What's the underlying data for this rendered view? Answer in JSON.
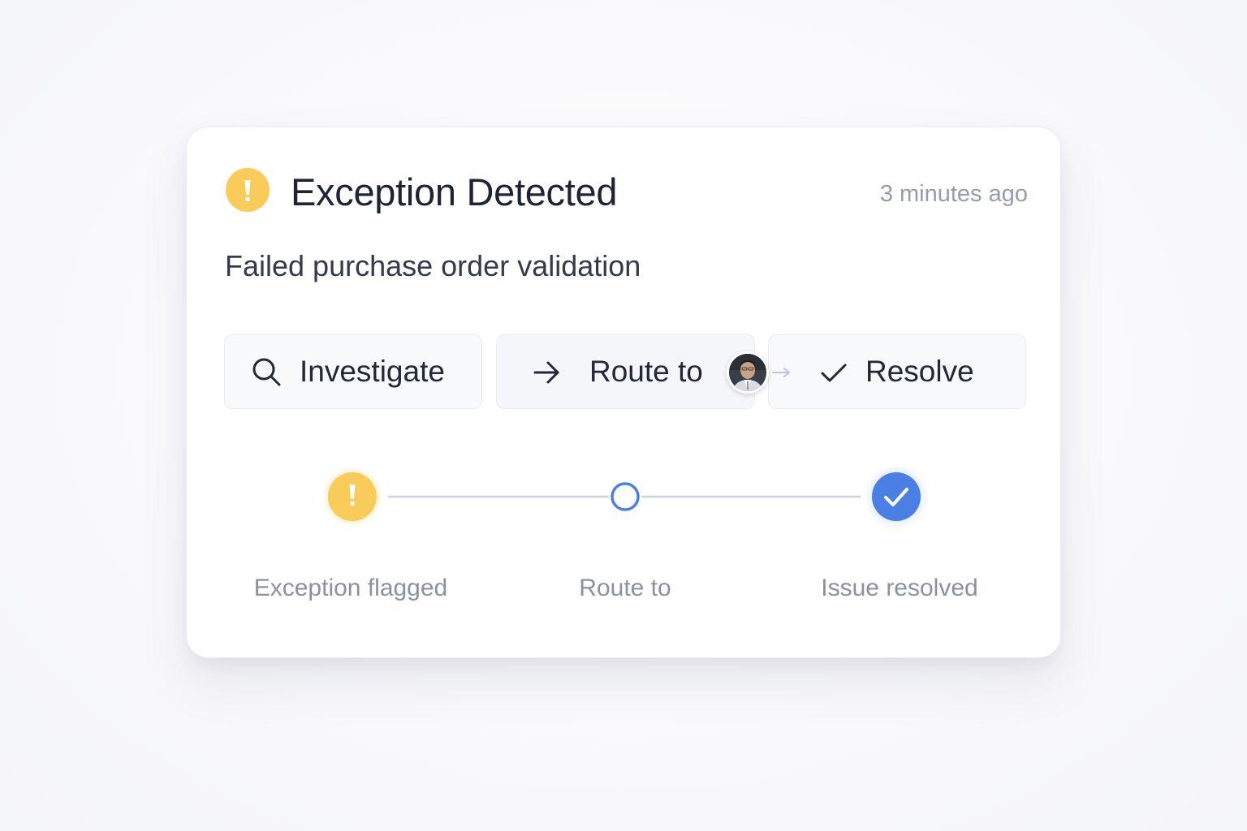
{
  "header": {
    "icon": "warning-icon",
    "title": "Exception Detected",
    "timestamp": "3 minutes ago"
  },
  "description": "Failed purchase order validation",
  "actions": [
    {
      "icon": "search-icon",
      "label": "Investigate"
    },
    {
      "icon": "arrow-right-icon",
      "label": "Route to",
      "assignee_icon": "avatar"
    },
    {
      "icon": "check-icon",
      "label": "Resolve"
    }
  ],
  "timeline": {
    "steps": [
      {
        "icon": "warning-icon",
        "label": "Exception flagged",
        "state": "flagged"
      },
      {
        "icon": "empty-circle-icon",
        "label": "Route to",
        "state": "pending"
      },
      {
        "icon": "check-circle-icon",
        "label": "Issue resolved",
        "state": "done"
      }
    ]
  },
  "colors": {
    "warning": "#f9cb58",
    "accent": "#4a80e4",
    "title_text": "#1e2433",
    "muted_text": "#8b91a0"
  }
}
